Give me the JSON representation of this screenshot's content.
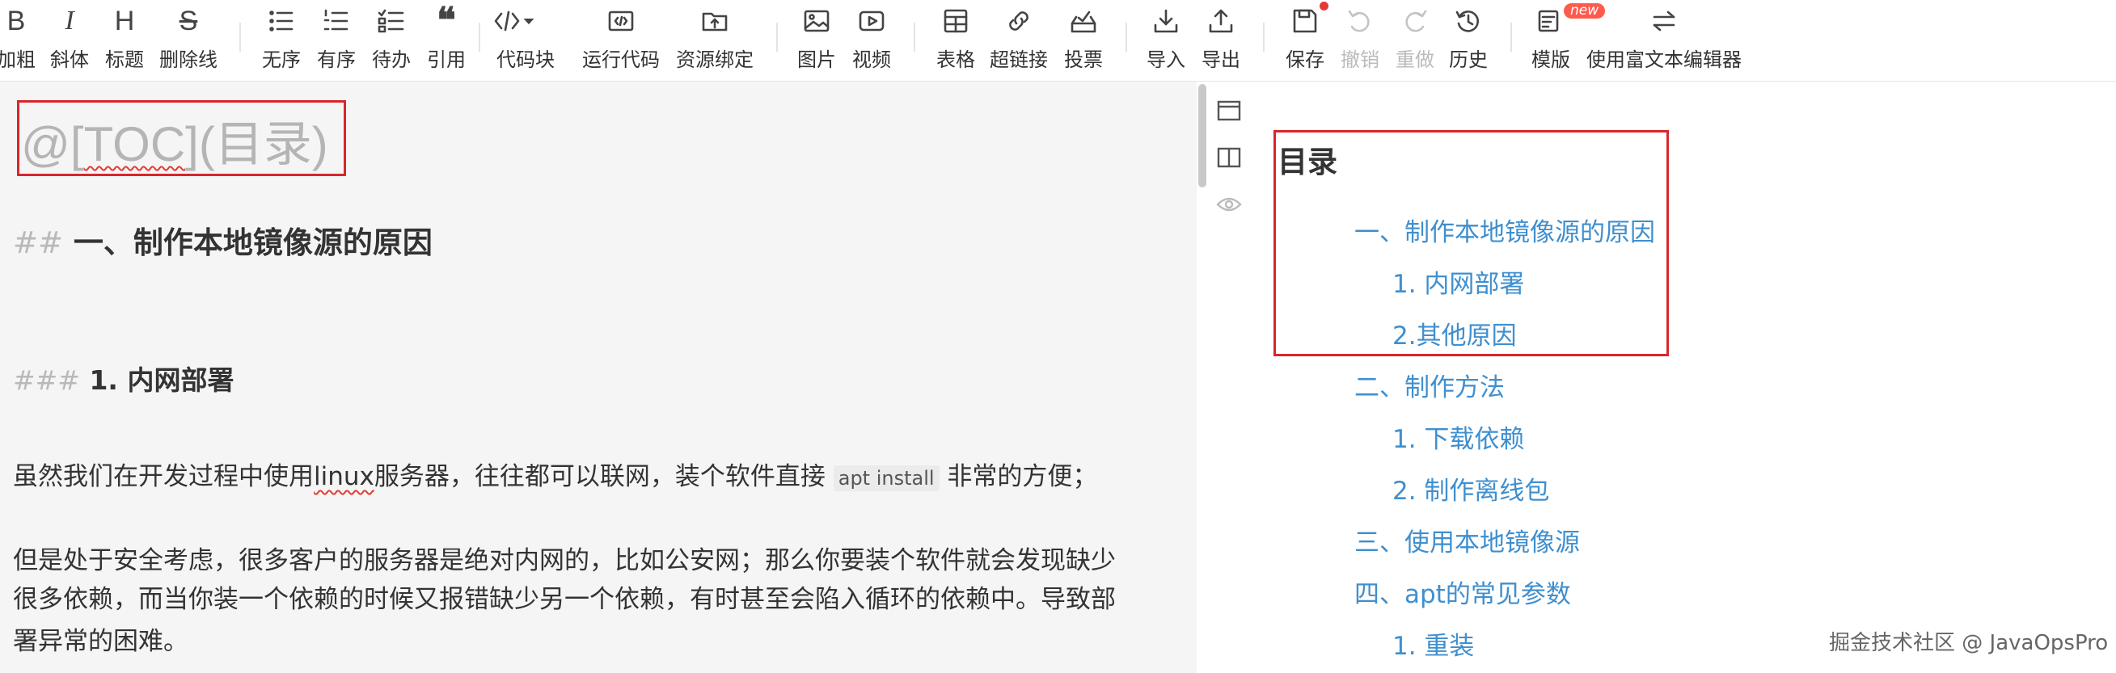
{
  "toolbar": {
    "bold": "加粗",
    "italic": "斜体",
    "heading": "标题",
    "strikethrough": "删除线",
    "unordered_list": "无序",
    "ordered_list": "有序",
    "todo": "待办",
    "quote": "引用",
    "code_block": "代码块",
    "run_code": "运行代码",
    "resource_bind": "资源绑定",
    "image": "图片",
    "video": "视频",
    "table": "表格",
    "hyperlink": "超链接",
    "vote": "投票",
    "import": "导入",
    "export": "导出",
    "save": "保存",
    "undo": "撤销",
    "redo": "重做",
    "history": "历史",
    "template": "模版",
    "template_badge": "new",
    "rich_text": "使用富文本编辑器"
  },
  "editor": {
    "toc_prefix": "@[",
    "toc_word": "TOC",
    "toc_suffix": "](目录)",
    "h2_marker": "##",
    "h2_text": "一、制作本地镜像源的原因",
    "h3_marker": "###",
    "h3_text": "1. 内网部署",
    "p1_before": "虽然我们在开发过程中使用",
    "p1_linux": "linux",
    "p1_middle": "服务器，往往都可以联网，装个软件直接",
    "p1_code": "apt install",
    "p1_after": "非常的方便；",
    "p2_line1": "但是处于安全考虑，很多客户的服务器是绝对内网的，比如公安网；那么你要装个软件就会发现缺少",
    "p2_line2": "很多依赖，而当你装一个依赖的时候又报错缺少另一个依赖，有时甚至会陷入循环的依赖中。导致部",
    "p2_line3": "署异常的困难。"
  },
  "preview": {
    "toc_title": "目录",
    "toc_items": [
      "一、制作本地镜像源的原因",
      "1. 内网部署",
      "2.其他原因",
      "二、制作方法",
      "1. 下载依赖",
      "2. 制作离线包",
      "三、使用本地镜像源",
      "四、apt的常见参数",
      "1. 重装"
    ]
  },
  "watermark": "掘金技术社区 @ JavaOpsPro",
  "colors": {
    "link": "#3f8fcf",
    "highlight_border": "#d8262c",
    "editor_bg": "#f5f5f5"
  }
}
